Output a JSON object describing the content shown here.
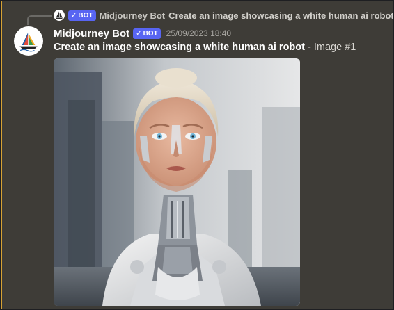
{
  "reply": {
    "author": "Midjourney Bot",
    "bot_tag": "BOT",
    "check_glyph": "✓",
    "text": "Create an image showcasing a white human ai robot -"
  },
  "message": {
    "author": "Midjourney Bot",
    "bot_tag": "BOT",
    "check_glyph": "✓",
    "timestamp": "25/09/2023 18:40",
    "prompt": "Create an image showcasing a white human ai robot",
    "suffix": " - Image #1"
  },
  "image": {
    "subject": "white humanoid ai robot with female face",
    "background_color": "#b9bdc1"
  },
  "colors": {
    "background": "#3e3c37",
    "highlight": "#d6a234",
    "bot_tag": "#5865f2"
  },
  "icons": [
    "sailboat-logo-icon",
    "verified-check-icon"
  ]
}
